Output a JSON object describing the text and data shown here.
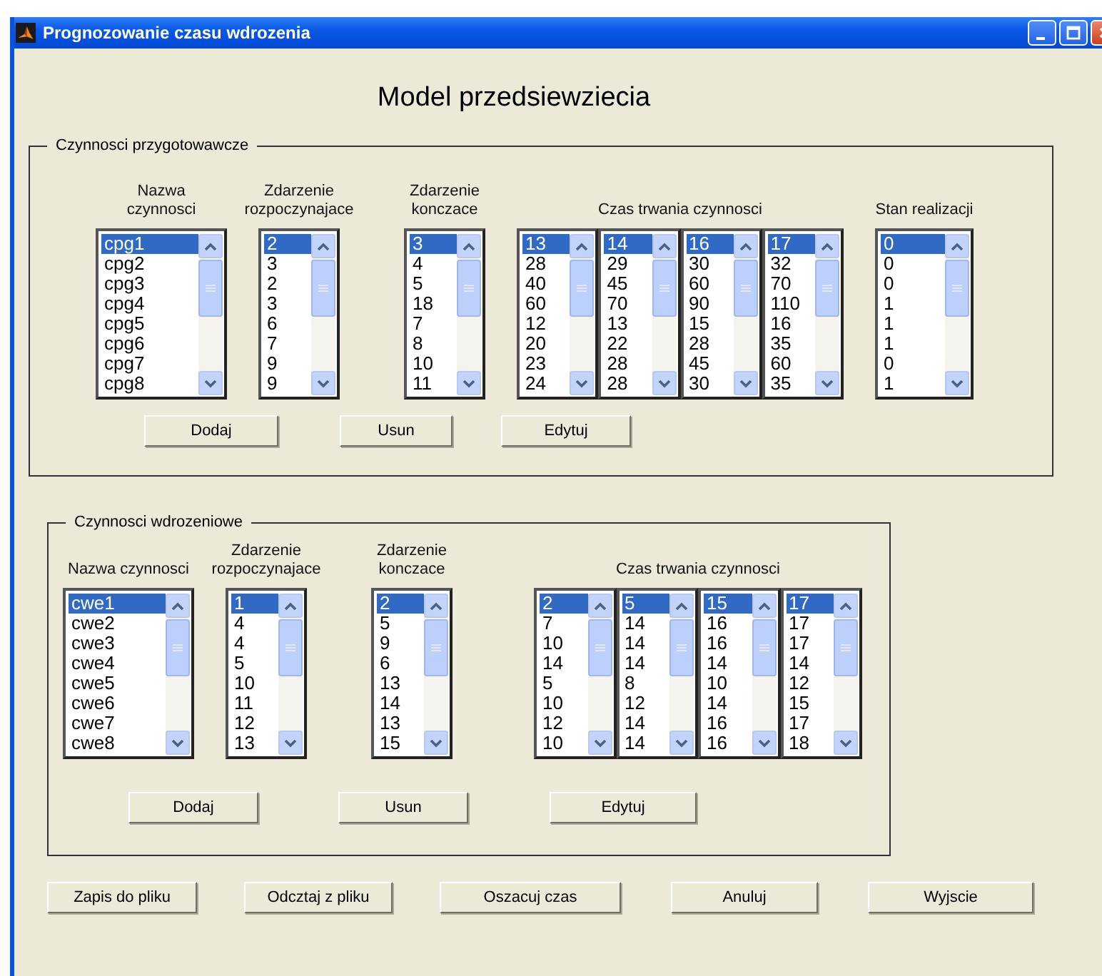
{
  "window": {
    "title": "Prognozowanie czasu wdrozenia"
  },
  "heading": "Model przedsiewziecia",
  "panels": [
    {
      "title": "Czynnosci przygotowawcze",
      "columns": [
        {
          "header": "Nazwa czynnosci",
          "lists": [
            {
              "items": [
                {
                  "label": "cpg1",
                  "selected": true
                },
                {
                  "label": "cpg2",
                  "selected": false
                },
                {
                  "label": "cpg3",
                  "selected": false
                },
                {
                  "label": "cpg4",
                  "selected": false
                },
                {
                  "label": "cpg5",
                  "selected": false
                },
                {
                  "label": "cpg6",
                  "selected": false
                },
                {
                  "label": "cpg7",
                  "selected": false
                },
                {
                  "label": "cpg8",
                  "selected": false
                }
              ]
            }
          ]
        },
        {
          "header": "Zdarzenie rozpoczynajace",
          "lists": [
            {
              "items": [
                {
                  "label": "2",
                  "selected": true
                },
                {
                  "label": "3",
                  "selected": false
                },
                {
                  "label": "2",
                  "selected": false
                },
                {
                  "label": "3",
                  "selected": false
                },
                {
                  "label": "6",
                  "selected": false
                },
                {
                  "label": "7",
                  "selected": false
                },
                {
                  "label": "9",
                  "selected": false
                },
                {
                  "label": "9",
                  "selected": false
                }
              ]
            }
          ]
        },
        {
          "header": "Zdarzenie konczace",
          "lists": [
            {
              "items": [
                {
                  "label": "3",
                  "selected": true
                },
                {
                  "label": "4",
                  "selected": false
                },
                {
                  "label": "5",
                  "selected": false
                },
                {
                  "label": "18",
                  "selected": false
                },
                {
                  "label": "7",
                  "selected": false
                },
                {
                  "label": "8",
                  "selected": false
                },
                {
                  "label": "10",
                  "selected": false
                },
                {
                  "label": "11",
                  "selected": false
                }
              ]
            }
          ]
        },
        {
          "header": "Czas trwania czynnosci",
          "lists": [
            {
              "items": [
                {
                  "label": "13",
                  "selected": true
                },
                {
                  "label": "28",
                  "selected": false
                },
                {
                  "label": "40",
                  "selected": false
                },
                {
                  "label": "60",
                  "selected": false
                },
                {
                  "label": "12",
                  "selected": false
                },
                {
                  "label": "20",
                  "selected": false
                },
                {
                  "label": "23",
                  "selected": false
                },
                {
                  "label": "24",
                  "selected": false
                }
              ]
            },
            {
              "items": [
                {
                  "label": "14",
                  "selected": true
                },
                {
                  "label": "29",
                  "selected": false
                },
                {
                  "label": "45",
                  "selected": false
                },
                {
                  "label": "70",
                  "selected": false
                },
                {
                  "label": "13",
                  "selected": false
                },
                {
                  "label": "22",
                  "selected": false
                },
                {
                  "label": "28",
                  "selected": false
                },
                {
                  "label": "28",
                  "selected": false
                }
              ]
            },
            {
              "items": [
                {
                  "label": "16",
                  "selected": true
                },
                {
                  "label": "30",
                  "selected": false
                },
                {
                  "label": "60",
                  "selected": false
                },
                {
                  "label": "90",
                  "selected": false
                },
                {
                  "label": "15",
                  "selected": false
                },
                {
                  "label": "28",
                  "selected": false
                },
                {
                  "label": "45",
                  "selected": false
                },
                {
                  "label": "30",
                  "selected": false
                }
              ]
            },
            {
              "items": [
                {
                  "label": "17",
                  "selected": true
                },
                {
                  "label": "32",
                  "selected": false
                },
                {
                  "label": "70",
                  "selected": false
                },
                {
                  "label": "110",
                  "selected": false
                },
                {
                  "label": "16",
                  "selected": false
                },
                {
                  "label": "35",
                  "selected": false
                },
                {
                  "label": "60",
                  "selected": false
                },
                {
                  "label": "35",
                  "selected": false
                }
              ]
            }
          ]
        },
        {
          "header": "Stan realizacji",
          "lists": [
            {
              "items": [
                {
                  "label": "0",
                  "selected": true
                },
                {
                  "label": "0",
                  "selected": false
                },
                {
                  "label": "0",
                  "selected": false
                },
                {
                  "label": "1",
                  "selected": false
                },
                {
                  "label": "1",
                  "selected": false
                },
                {
                  "label": "1",
                  "selected": false
                },
                {
                  "label": "0",
                  "selected": false
                },
                {
                  "label": "1",
                  "selected": false
                }
              ]
            }
          ]
        }
      ],
      "buttons": [
        "Dodaj",
        "Usun",
        "Edytuj"
      ]
    },
    {
      "title": "Czynnosci wdrozeniowe",
      "columns": [
        {
          "header": "Nazwa czynnosci",
          "lists": [
            {
              "items": [
                {
                  "label": "cwe1",
                  "selected": true
                },
                {
                  "label": "cwe2",
                  "selected": false
                },
                {
                  "label": "cwe3",
                  "selected": false
                },
                {
                  "label": "cwe4",
                  "selected": false
                },
                {
                  "label": "cwe5",
                  "selected": false
                },
                {
                  "label": "cwe6",
                  "selected": false
                },
                {
                  "label": "cwe7",
                  "selected": false
                },
                {
                  "label": "cwe8",
                  "selected": false
                }
              ]
            }
          ]
        },
        {
          "header": "Zdarzenie rozpoczynajace",
          "lists": [
            {
              "items": [
                {
                  "label": "1",
                  "selected": true
                },
                {
                  "label": "4",
                  "selected": false
                },
                {
                  "label": "4",
                  "selected": false
                },
                {
                  "label": "5",
                  "selected": false
                },
                {
                  "label": "10",
                  "selected": false
                },
                {
                  "label": "11",
                  "selected": false
                },
                {
                  "label": "12",
                  "selected": false
                },
                {
                  "label": "13",
                  "selected": false
                }
              ]
            }
          ]
        },
        {
          "header": "Zdarzenie konczace",
          "lists": [
            {
              "items": [
                {
                  "label": "2",
                  "selected": true
                },
                {
                  "label": "5",
                  "selected": false
                },
                {
                  "label": "9",
                  "selected": false
                },
                {
                  "label": "6",
                  "selected": false
                },
                {
                  "label": "13",
                  "selected": false
                },
                {
                  "label": "14",
                  "selected": false
                },
                {
                  "label": "13",
                  "selected": false
                },
                {
                  "label": "15",
                  "selected": false
                }
              ]
            }
          ]
        },
        {
          "header": "Czas trwania czynnosci",
          "lists": [
            {
              "items": [
                {
                  "label": "2",
                  "selected": true
                },
                {
                  "label": "7",
                  "selected": false
                },
                {
                  "label": "10",
                  "selected": false
                },
                {
                  "label": "14",
                  "selected": false
                },
                {
                  "label": "5",
                  "selected": false
                },
                {
                  "label": "10",
                  "selected": false
                },
                {
                  "label": "12",
                  "selected": false
                },
                {
                  "label": "10",
                  "selected": false
                }
              ]
            },
            {
              "items": [
                {
                  "label": "5",
                  "selected": true
                },
                {
                  "label": "14",
                  "selected": false
                },
                {
                  "label": "14",
                  "selected": false
                },
                {
                  "label": "14",
                  "selected": false
                },
                {
                  "label": "8",
                  "selected": false
                },
                {
                  "label": "12",
                  "selected": false
                },
                {
                  "label": "14",
                  "selected": false
                },
                {
                  "label": "14",
                  "selected": false
                }
              ]
            },
            {
              "items": [
                {
                  "label": "15",
                  "selected": true
                },
                {
                  "label": "16",
                  "selected": false
                },
                {
                  "label": "16",
                  "selected": false
                },
                {
                  "label": "14",
                  "selected": false
                },
                {
                  "label": "10",
                  "selected": false
                },
                {
                  "label": "14",
                  "selected": false
                },
                {
                  "label": "16",
                  "selected": false
                },
                {
                  "label": "16",
                  "selected": false
                }
              ]
            },
            {
              "items": [
                {
                  "label": "17",
                  "selected": true
                },
                {
                  "label": "17",
                  "selected": false
                },
                {
                  "label": "17",
                  "selected": false
                },
                {
                  "label": "14",
                  "selected": false
                },
                {
                  "label": "12",
                  "selected": false
                },
                {
                  "label": "15",
                  "selected": false
                },
                {
                  "label": "17",
                  "selected": false
                },
                {
                  "label": "18",
                  "selected": false
                }
              ]
            }
          ]
        }
      ],
      "buttons": [
        "Dodaj",
        "Usun",
        "Edytuj"
      ]
    }
  ],
  "buttons": [
    "Zapis do pliku",
    "Odcztaj z pliku",
    "Oszacuj czas",
    "Anuluj",
    "Wyjscie"
  ]
}
